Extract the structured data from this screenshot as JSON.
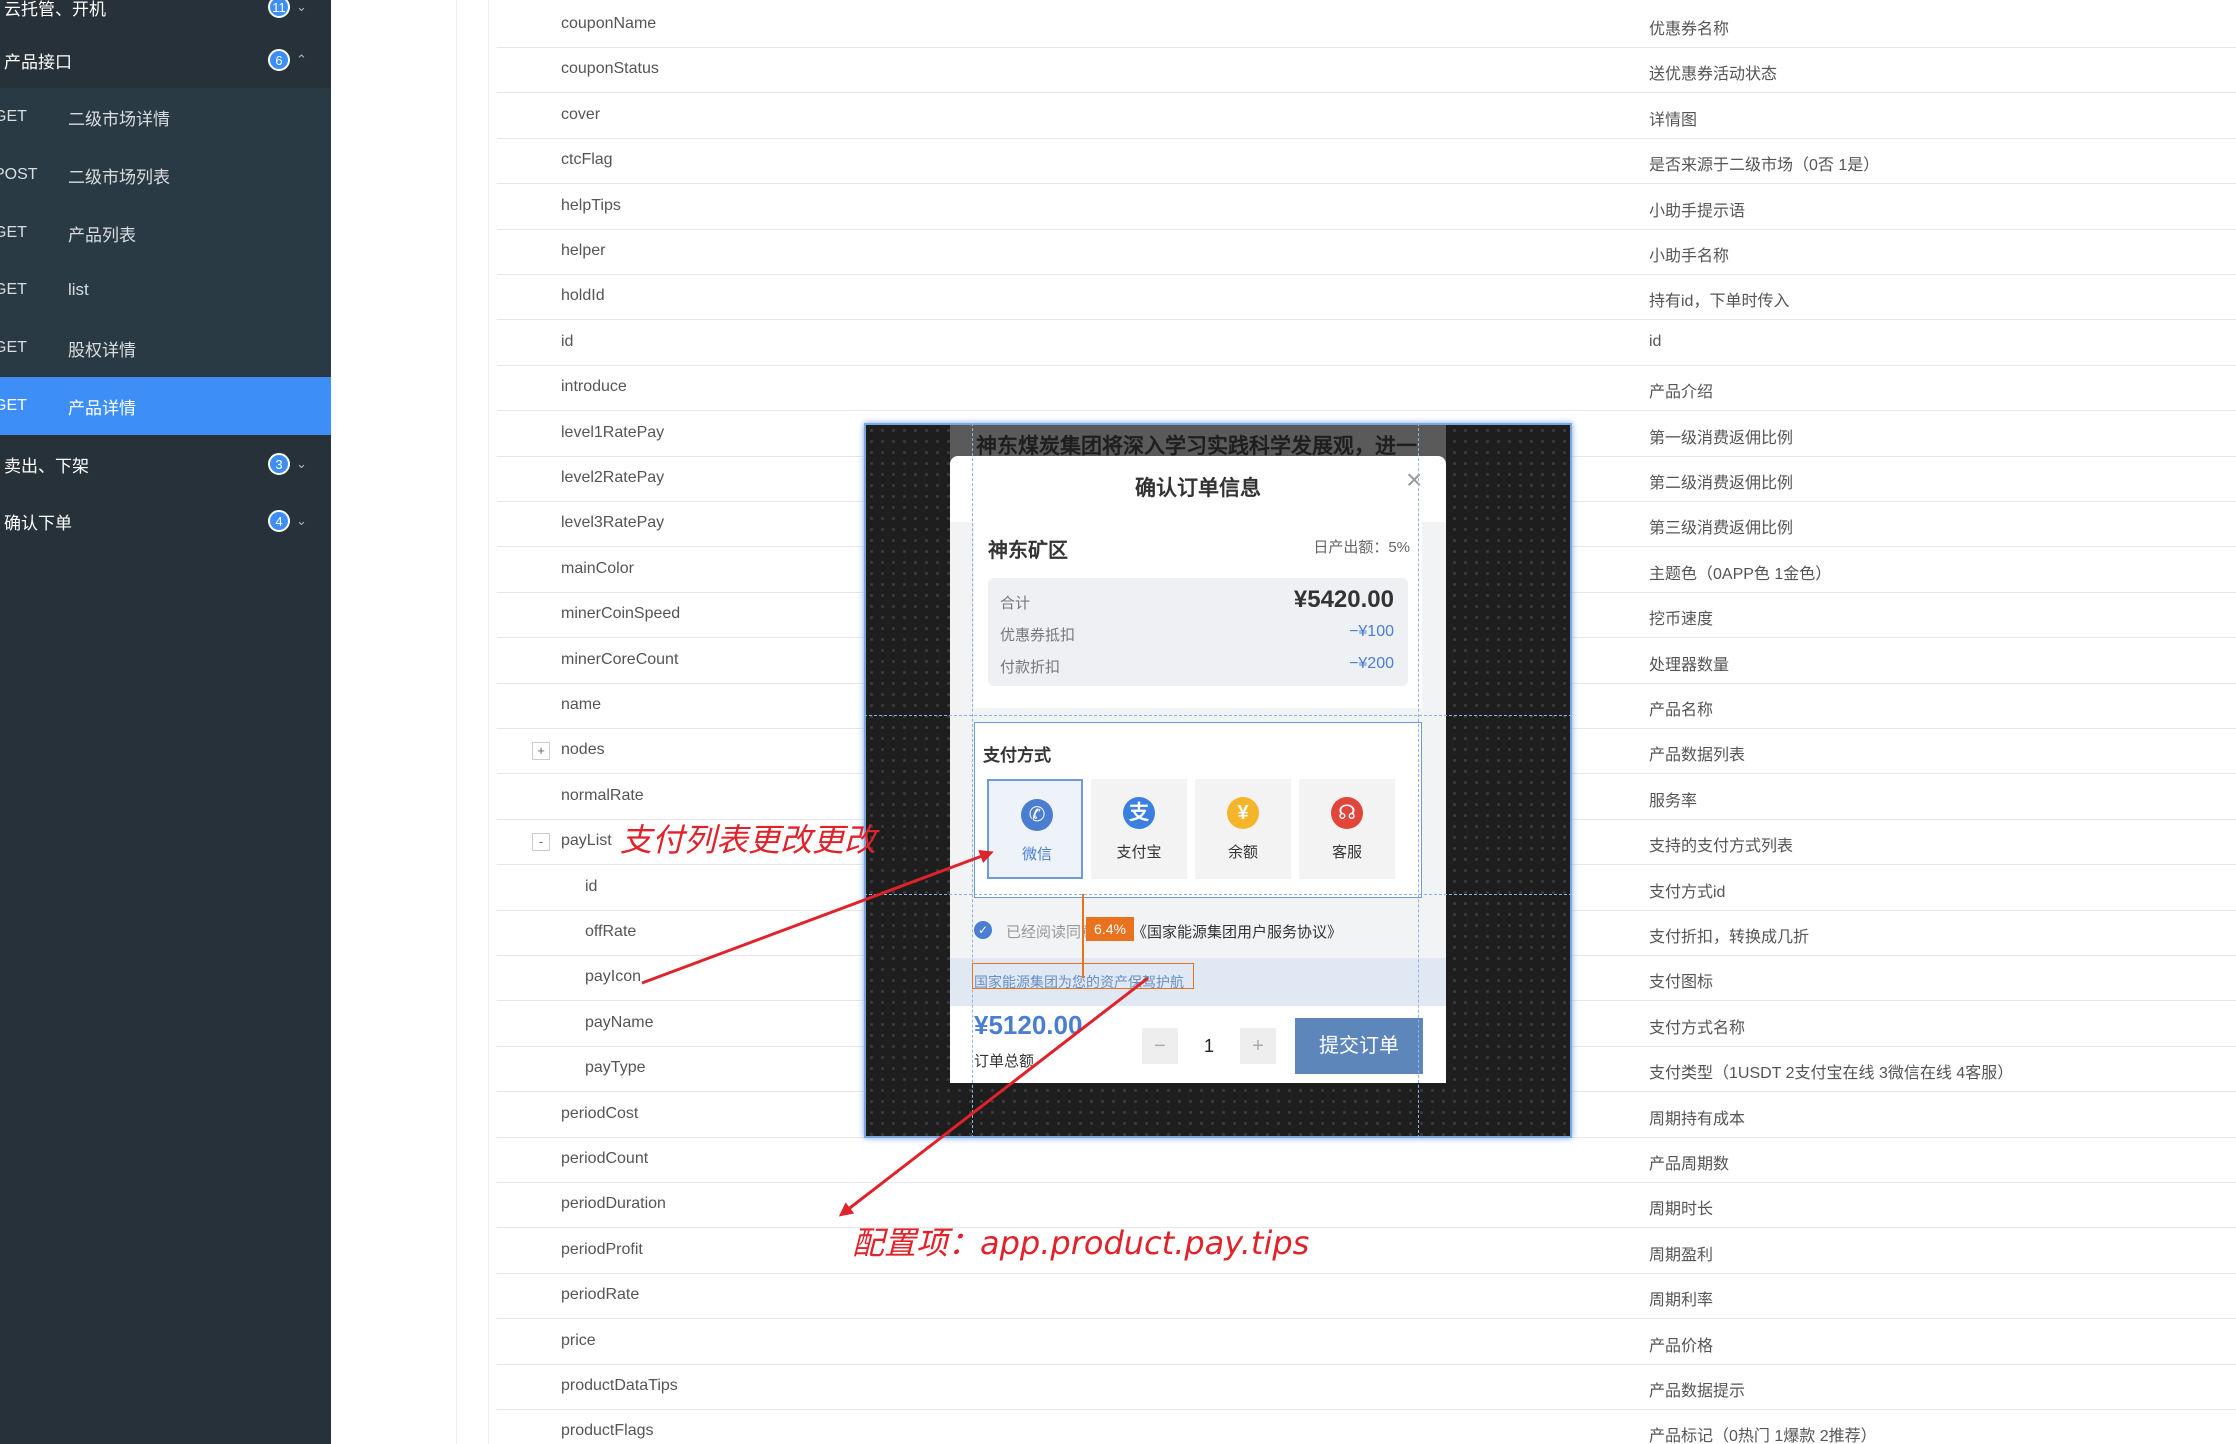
{
  "sidebar": {
    "items": [
      {
        "label": "云托管、开机",
        "badge": "11",
        "chevron": "⌄",
        "type": "group"
      },
      {
        "label": "产品接口",
        "badge": "6",
        "chevron": "⌃",
        "type": "group"
      },
      {
        "method": "GET",
        "label": "二级市场详情",
        "type": "sub"
      },
      {
        "method": "POST",
        "label": "二级市场列表",
        "type": "sub"
      },
      {
        "method": "GET",
        "label": "产品列表",
        "type": "sub"
      },
      {
        "method": "GET",
        "label": "list",
        "type": "sub"
      },
      {
        "method": "GET",
        "label": "股权详情",
        "type": "sub"
      },
      {
        "method": "GET",
        "label": "产品详情",
        "type": "sub",
        "active": true
      },
      {
        "label": "卖出、下架",
        "badge": "3",
        "chevron": "⌄",
        "type": "group"
      },
      {
        "label": "确认下单",
        "badge": "4",
        "chevron": "⌄",
        "type": "group"
      }
    ]
  },
  "table": {
    "rows": [
      {
        "name": "couponName",
        "desc": "优惠券名称"
      },
      {
        "name": "couponStatus",
        "desc": "送优惠券活动状态"
      },
      {
        "name": "cover",
        "desc": "详情图"
      },
      {
        "name": "ctcFlag",
        "desc": "是否来源于二级市场（0否 1是）"
      },
      {
        "name": "helpTips",
        "desc": "小助手提示语"
      },
      {
        "name": "helper",
        "desc": "小助手名称"
      },
      {
        "name": "holdId",
        "desc": "持有id，下单时传入"
      },
      {
        "name": "id",
        "desc": "id"
      },
      {
        "name": "introduce",
        "desc": "产品介绍"
      },
      {
        "name": "level1RatePay",
        "desc": "第一级消费返佣比例"
      },
      {
        "name": "level2RatePay",
        "desc": "第二级消费返佣比例"
      },
      {
        "name": "level3RatePay",
        "desc": "第三级消费返佣比例"
      },
      {
        "name": "mainColor",
        "desc": "主题色（0APP色 1金色）"
      },
      {
        "name": "minerCoinSpeed",
        "desc": "挖币速度"
      },
      {
        "name": "minerCoreCount",
        "desc": "处理器数量"
      },
      {
        "name": "name",
        "desc": "产品名称"
      },
      {
        "name": "nodes",
        "desc": "产品数据列表",
        "toggle": "+"
      },
      {
        "name": "normalRate",
        "desc": "服务率"
      },
      {
        "name": "payList",
        "desc": "支持的支付方式列表",
        "toggle": "-"
      },
      {
        "name": "id",
        "desc": "支付方式id",
        "child": true
      },
      {
        "name": "offRate",
        "desc": "支付折扣，转换成几折",
        "child": true
      },
      {
        "name": "payIcon",
        "desc": "支付图标",
        "child": true
      },
      {
        "name": "payName",
        "desc": "支付方式名称",
        "child": true
      },
      {
        "name": "payType",
        "desc": "支付类型（1USDT 2支付宝在线 3微信在线 4客服）",
        "child": true
      },
      {
        "name": "periodCost",
        "desc": "周期持有成本"
      },
      {
        "name": "periodCount",
        "desc": "产品周期数"
      },
      {
        "name": "periodDuration",
        "desc": "周期时长"
      },
      {
        "name": "periodProfit",
        "desc": "周期盈利"
      },
      {
        "name": "periodRate",
        "desc": "周期利率"
      },
      {
        "name": "price",
        "desc": "产品价格"
      },
      {
        "name": "productDataTips",
        "desc": "产品数据提示"
      },
      {
        "name": "productFlags",
        "desc": "产品标记（0热门 1爆款 2推荐）"
      }
    ]
  },
  "phone": {
    "headline": "神东煤炭集团将深入学习实践科学发展观，进一",
    "modal_title": "确认订单信息",
    "close_glyph": "×",
    "mine_name": "神东矿区",
    "daily_output": "日产出额：5%",
    "total_label": "合计",
    "total_value": "¥5420.00",
    "coupon_label": "优惠券抵扣",
    "coupon_value": "−¥100",
    "discount_label": "付款折扣",
    "discount_value": "−¥200",
    "pay_method_title": "支付方式",
    "pay_methods": [
      {
        "label": "微信",
        "icon": "wechat-icon",
        "color": "#4a7ed0",
        "glyph": "✆",
        "selected": true
      },
      {
        "label": "支付宝",
        "icon": "alipay-icon",
        "color": "#3b7fe0",
        "glyph": "支"
      },
      {
        "label": "余额",
        "icon": "balance-icon",
        "color": "#f5b52b",
        "glyph": "¥"
      },
      {
        "label": "客服",
        "icon": "service-icon",
        "color": "#e2463a",
        "glyph": "☊"
      }
    ],
    "agree_prefix": "已经阅读同意",
    "agree_link": "《国家能源集团用户服务协议》",
    "tips": "国家能源集团为您的资产保驾护航",
    "footer_price": "¥5120.00",
    "footer_label": "订单总额",
    "qty_minus": "−",
    "qty_value": "1",
    "qty_plus": "+",
    "submit": "提交订单",
    "measure": "6.4%"
  },
  "annotations": {
    "paylist_note": "支付列表更改更改",
    "config_note": "配置项：app.product.pay.tips"
  },
  "colors": {
    "sidebar_bg": "#263139",
    "accent": "#3d8ff7",
    "annotation": "#e0222a",
    "measure": "#e8721d"
  }
}
